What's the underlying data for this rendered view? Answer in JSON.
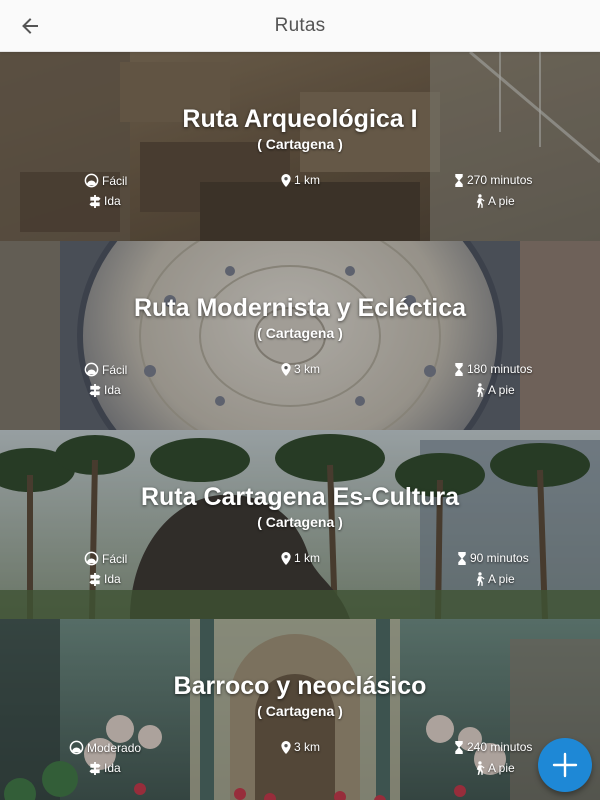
{
  "app_bar": {
    "title": "Rutas",
    "back_icon": "arrow-left-icon"
  },
  "routes": [
    {
      "title": "Ruta Arqueológica I",
      "city": "( Cartagena )",
      "difficulty": "Fácil",
      "distance": "1 km",
      "duration": "270 minutos",
      "direction": "Ida",
      "mode": "A pie",
      "theme": "archaeological-ruins"
    },
    {
      "title": "Ruta Modernista y Ecléctica",
      "city": "( Cartagena )",
      "difficulty": "Fácil",
      "distance": "3 km",
      "duration": "180 minutos",
      "direction": "Ida",
      "mode": "A pie",
      "theme": "modernist-dome"
    },
    {
      "title": "Ruta Cartagena Es-Cultura",
      "city": "( Cartagena )",
      "difficulty": "Fácil",
      "distance": "1 km",
      "duration": "90 minutos",
      "direction": "Ida",
      "mode": "A pie",
      "theme": "sculpture-palm-trees"
    },
    {
      "title": "Barroco y neoclásico",
      "city": "( Cartagena )",
      "difficulty": "Moderado",
      "distance": "3 km",
      "duration": "240 minutos",
      "direction": "Ida",
      "mode": "A pie",
      "theme": "baroque-church-interior"
    }
  ],
  "fab": {
    "icon": "plus-icon",
    "color": "#1e88d6"
  },
  "colors": {
    "app_bar_bg": "#fafafa",
    "title_text": "#555555",
    "card_text": "#ffffff"
  }
}
